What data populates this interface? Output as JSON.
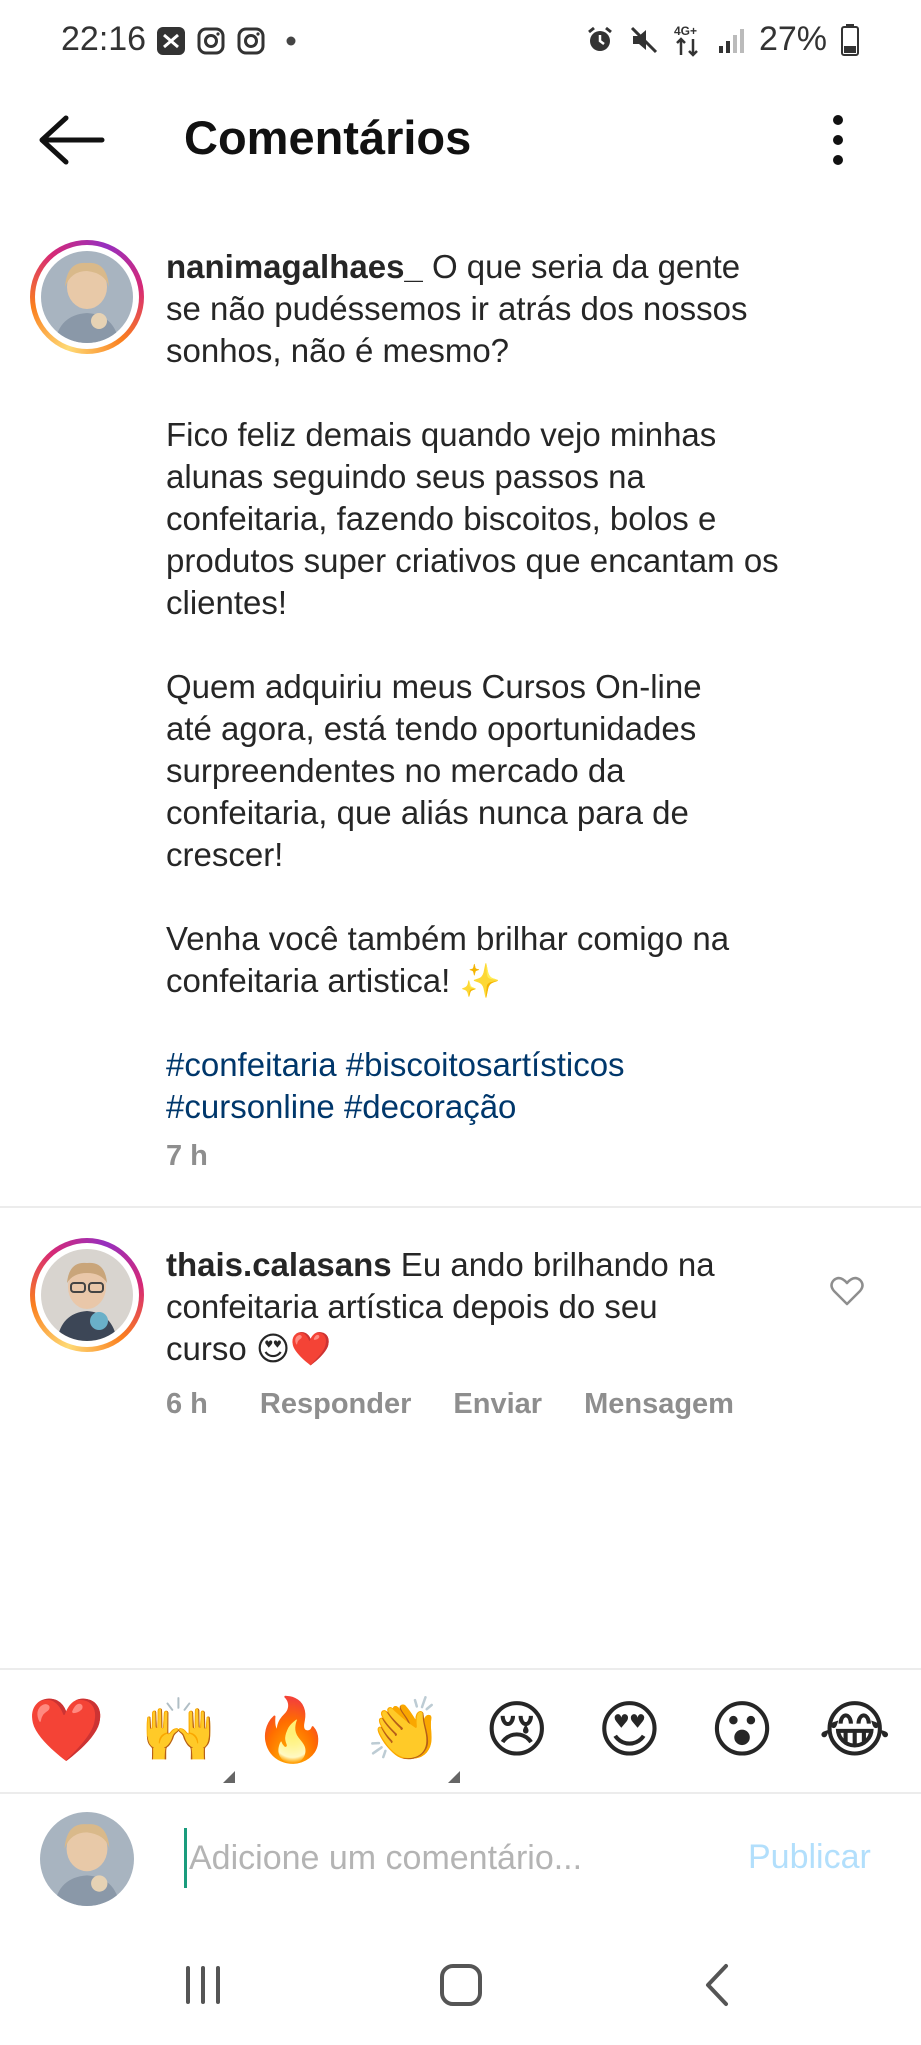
{
  "status_bar": {
    "time": "22:16",
    "battery": "27%",
    "network": "4G+",
    "icons": [
      "x-app-icon",
      "instagram-icon",
      "instagram-icon",
      "dot-icon",
      "alarm-icon",
      "mute-icon",
      "network-icon",
      "signal-icon",
      "battery-icon"
    ]
  },
  "header": {
    "title": "Comentários",
    "back_icon": "back-arrow-icon",
    "more_icon": "more-vertical-icon"
  },
  "post": {
    "username": "nanimagalhaes_",
    "text_intro": " O que seria da gente\nse não pudéssemos ir atrás dos nossos\nsonhos, não é mesmo?\n\nFico feliz demais quando vejo minhas\nalunas seguindo seus passos na\nconfeitaria, fazendo biscoitos, bolos e\nprodutos super criativos que encantam os\nclientes!\n\nQuem adquiriu meus Cursos On-line\naté agora, está tendo oportunidades\nsurpreendentes no mercado da\nconfeitaria, que aliás nunca para de\ncrescer!\n\nVenha você também brilhar comigo na\nconfeitaria artistica! ✨\n\n",
    "hashtags_line1": "#confeitaria #biscoitosartísticos",
    "hashtags_line2": "#cursonline #decoração",
    "time": "7 h"
  },
  "reply": {
    "username": "thais.calasans",
    "text": " Eu ando brilhando na\nconfeitaria artística depois do seu\ncurso 😍❤️",
    "time": "6 h",
    "actions": [
      "Responder",
      "Enviar",
      "Mensagem"
    ]
  },
  "emoji_bar": {
    "emojis": [
      "❤️",
      "🙌",
      "🔥",
      "👏",
      "😢",
      "😍",
      "😮",
      "😂"
    ]
  },
  "composer": {
    "placeholder": "Adicione um comentário...",
    "value": "",
    "publish_label": "Publicar"
  },
  "colors": {
    "hashtag": "#00376b",
    "publish_disabled": "#b2dffc",
    "meta_gray": "#8e8e8e",
    "cursor": "#1a9c7d"
  }
}
